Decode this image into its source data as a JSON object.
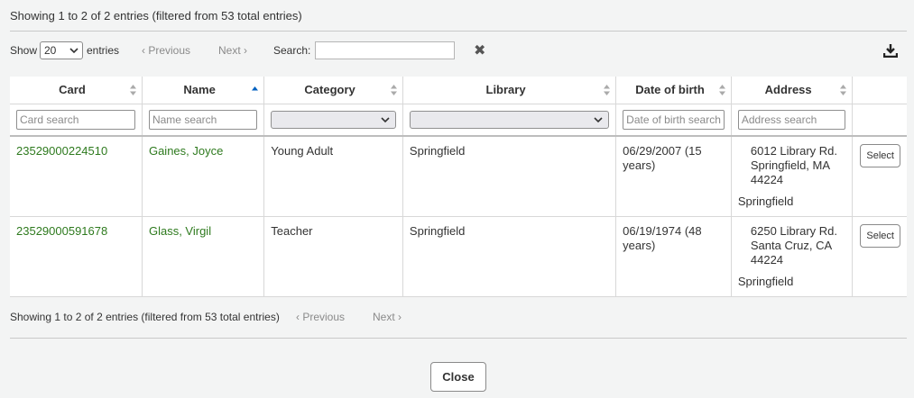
{
  "info": {
    "top": "Showing 1 to 2 of 2 entries (filtered from 53 total entries)",
    "bottom": "Showing 1 to 2 of 2 entries (filtered from 53 total entries)"
  },
  "controls": {
    "show_label": "Show",
    "page_size": "20",
    "entries_label": "entries",
    "previous": "Previous",
    "next": "Next",
    "search_label": "Search:",
    "search_value": ""
  },
  "table": {
    "headers": [
      "Card",
      "Name",
      "Category",
      "Library",
      "Date of birth",
      "Address"
    ],
    "sorted_column": "Name",
    "filters": {
      "card": "Card search",
      "name": "Name search",
      "dob": "Date of birth search",
      "address": "Address search"
    },
    "rows": [
      {
        "card": "23529000224510",
        "name": "Gaines, Joyce",
        "category": "Young Adult",
        "library": "Springfield",
        "dob": "06/29/2007 (15 years)",
        "addr_line1": "6012 Library Rd.",
        "addr_line2": "Springfield, MA",
        "addr_line3": "44224",
        "addr_library": "Springfield",
        "action": "Select"
      },
      {
        "card": "23529000591678",
        "name": "Glass, Virgil",
        "category": "Teacher",
        "library": "Springfield",
        "dob": "06/19/1974 (48 years)",
        "addr_line1": "6250 Library Rd.",
        "addr_line2": "Santa Cruz, CA",
        "addr_line3": "44224",
        "addr_library": "Springfield",
        "action": "Select"
      }
    ]
  },
  "close_label": "Close",
  "colors": {
    "link_green": "#2e7a1e",
    "background": "#f3f4f4",
    "sort_active": "#0060c0"
  },
  "icons": {
    "clear": "clear-filter-icon",
    "download": "download-icon",
    "sort": "sort-icon",
    "chevron": "chevron-down-icon"
  }
}
